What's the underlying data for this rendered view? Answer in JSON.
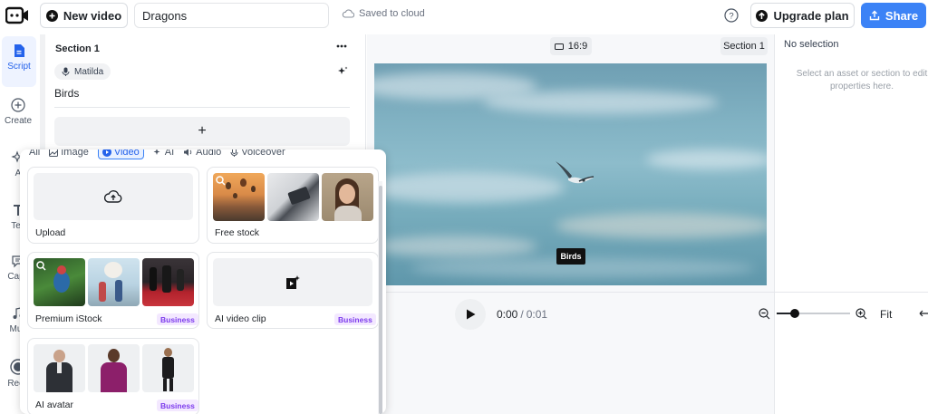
{
  "topbar": {
    "new_video_label": "New video",
    "title_value": "Dragons",
    "saved_status": "Saved to cloud",
    "upgrade_label": "Upgrade plan",
    "share_label": "Share"
  },
  "rail": {
    "items": [
      {
        "label": "Script",
        "icon": "document-icon"
      },
      {
        "label": "Create",
        "icon": "plus-circle-icon"
      },
      {
        "label": "A",
        "icon": "sparkle-icon"
      },
      {
        "label": "Tex",
        "icon": "text-icon"
      },
      {
        "label": "Capti",
        "icon": "caption-icon"
      },
      {
        "label": "Mus",
        "icon": "music-icon"
      },
      {
        "label": "Reco",
        "icon": "record-icon"
      }
    ]
  },
  "script": {
    "section_title": "Section 1",
    "voice_name": "Matilda",
    "script_text": "Birds",
    "add_label": "+"
  },
  "media_popup": {
    "tabs": [
      {
        "label": "All",
        "icon": ""
      },
      {
        "label": "Image",
        "icon": "image-icon"
      },
      {
        "label": "Video",
        "icon": "video-icon"
      },
      {
        "label": "AI",
        "icon": "sparkle-icon"
      },
      {
        "label": "Audio",
        "icon": "speaker-icon"
      },
      {
        "label": "Voiceover",
        "icon": "mic-icon"
      }
    ],
    "active_tab": "Video",
    "cards": {
      "upload": "Upload",
      "free_stock": "Free stock",
      "premium_istock": "Premium iStock",
      "ai_video_clip": "AI video clip",
      "ai_avatar": "AI avatar"
    },
    "badge_label": "Business"
  },
  "canvas": {
    "aspect_label": "16:9",
    "section_label": "Section 1",
    "subtitle": "Birds"
  },
  "properties": {
    "header": "No selection",
    "hint": "Select an asset or section to edit properties here."
  },
  "player": {
    "current_time": "0:00",
    "separator": "/",
    "duration": "0:01",
    "fit_label": "Fit",
    "zoom_level": 0.25
  },
  "colors": {
    "accent": "#3b82f6",
    "badge_bg": "#f3e8ff",
    "badge_text": "#7c3aed"
  }
}
